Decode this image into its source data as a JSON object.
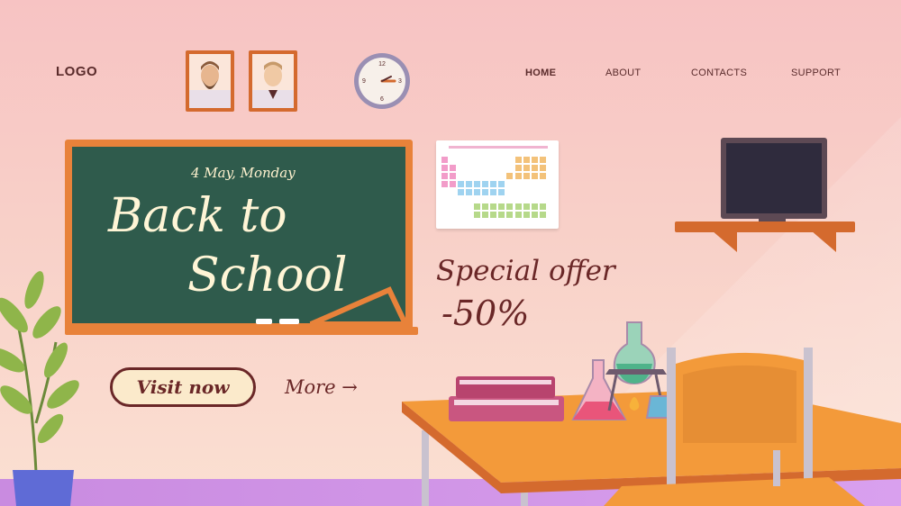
{
  "header": {
    "logo": "LOGO",
    "nav": [
      {
        "label": "HOME",
        "active": true
      },
      {
        "label": "ABOUT",
        "active": false
      },
      {
        "label": "CONTACTS",
        "active": false
      },
      {
        "label": "SUPPORT",
        "active": false
      }
    ]
  },
  "clock": {
    "numbers": [
      "12",
      "3",
      "6",
      "9"
    ]
  },
  "board": {
    "date": "4 May, Monday",
    "title_line1": "Back to",
    "title_line2": "School"
  },
  "offer": {
    "line1": "Special offer",
    "line2": "-50%"
  },
  "cta": {
    "visit_label": "Visit now",
    "more_label": "More →"
  },
  "colors": {
    "accent": "#6a2727",
    "board": "#2f5b4c",
    "wood": "#e8823a"
  }
}
